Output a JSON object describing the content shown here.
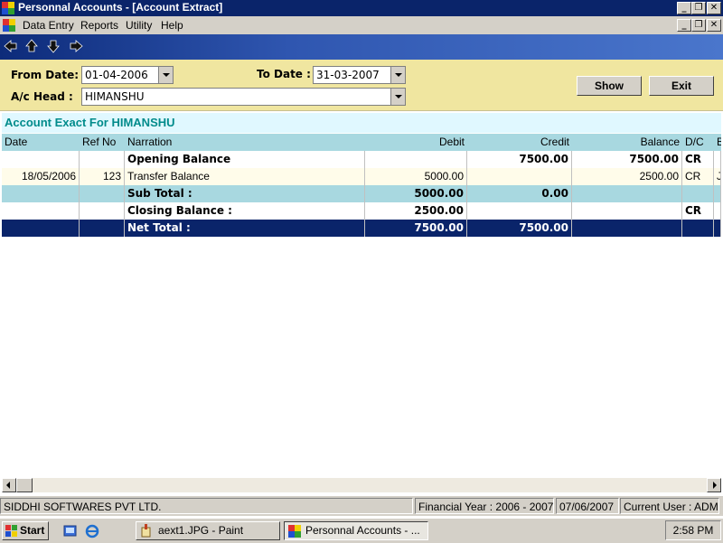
{
  "window": {
    "title": "Personnal Accounts - [Account Extract]",
    "controls": [
      "_",
      "❐",
      "✕"
    ]
  },
  "menu": {
    "items": [
      {
        "label": "Data Entry"
      },
      {
        "label": "Reports"
      },
      {
        "label": "Utility"
      },
      {
        "label": "Help"
      }
    ],
    "controls": [
      "_",
      "❐",
      "✕"
    ]
  },
  "toolbar": {
    "icons": [
      "arrow-left-icon",
      "arrow-up-icon",
      "arrow-down-icon",
      "arrow-right-icon"
    ]
  },
  "filters": {
    "from_date_label": "From Date:",
    "from_date_value": "01-04-2006",
    "to_date_label": "To Date :",
    "to_date_value": "31-03-2007",
    "ac_head_label": "A/c Head :",
    "ac_head_value": "HIMANSHU",
    "show_button": "Show",
    "exit_button": "Exit"
  },
  "report": {
    "heading": "Account Exact For HIMANSHU",
    "columns": [
      "Date",
      "Ref No",
      "Narration",
      "Debit",
      "Credit",
      "Balance",
      "D/C",
      "B"
    ],
    "rows": [
      {
        "type": "opening",
        "date": "",
        "ref": "",
        "narration": "Opening Balance",
        "debit": "",
        "credit": "7500.00",
        "balance": "7500.00",
        "dc": "CR",
        "extra": ""
      },
      {
        "type": "transaction",
        "date": "18/05/2006",
        "ref": "123",
        "narration": "Transfer Balance",
        "debit": "5000.00",
        "credit": "",
        "balance": "2500.00",
        "dc": "CR",
        "extra": "J"
      },
      {
        "type": "subtotal",
        "date": "",
        "ref": "",
        "narration": "Sub Total :",
        "debit": "5000.00",
        "credit": "0.00",
        "balance": "",
        "dc": "",
        "extra": ""
      },
      {
        "type": "closing",
        "date": "",
        "ref": "",
        "narration": "Closing Balance :",
        "debit": "2500.00",
        "credit": "",
        "balance": "",
        "dc": "CR",
        "extra": ""
      },
      {
        "type": "net",
        "date": "",
        "ref": "",
        "narration": "Net Total :",
        "debit": "7500.00",
        "credit": "7500.00",
        "balance": "",
        "dc": "",
        "extra": ""
      }
    ]
  },
  "status": {
    "company": "SIDDHI SOFTWARES PVT LTD.",
    "financial_year": "Financial Year : 2006 - 2007",
    "date": "07/06/2007",
    "user": "Current User : ADM"
  },
  "taskbar": {
    "start": "Start",
    "tasks": [
      {
        "label": "aext1.JPG - Paint",
        "active": false
      },
      {
        "label": "Personnal Accounts - ...",
        "active": true
      }
    ],
    "clock": "2:58 PM"
  },
  "colors": {
    "titlebar": "#0a246a",
    "filter_panel": "#f0e6a0",
    "header_row": "#a8d8e0",
    "net_total_row": "#0a246a",
    "heading_text": "#008b8b"
  }
}
